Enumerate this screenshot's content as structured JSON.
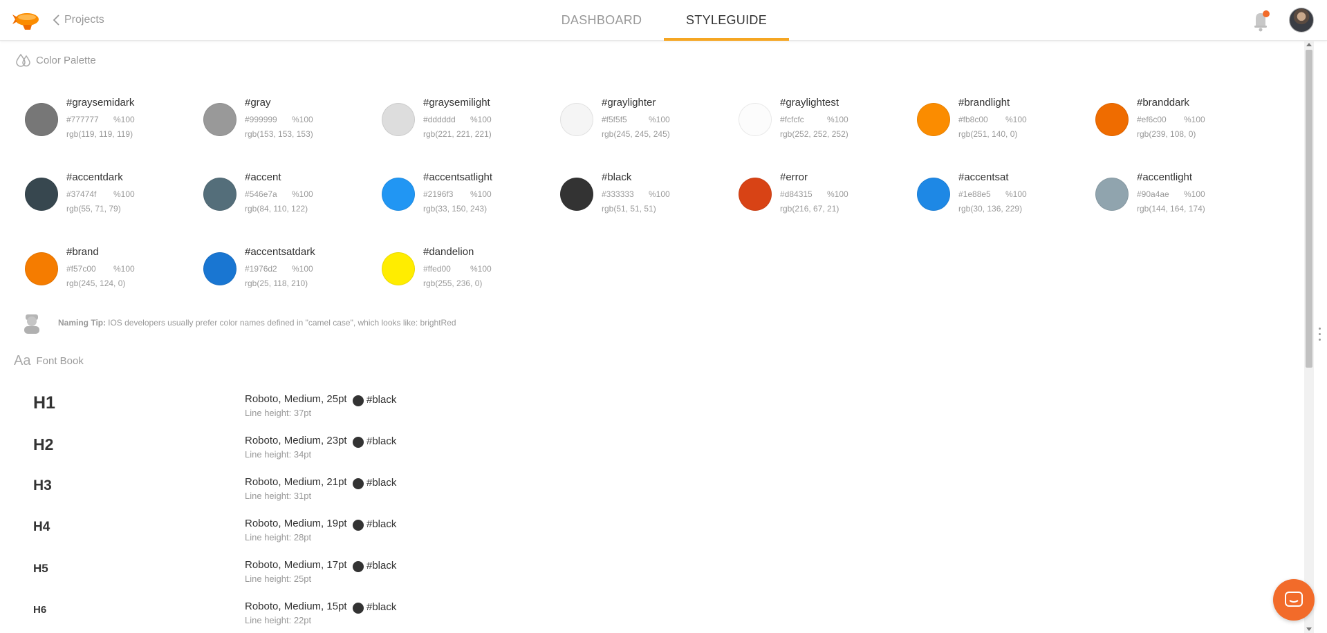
{
  "nav": {
    "back_label": "Projects",
    "tabs": [
      {
        "label": "DASHBOARD",
        "active": false
      },
      {
        "label": "STYLEGUIDE",
        "active": true
      }
    ],
    "accent_color": "#f5a623"
  },
  "color_palette": {
    "title": "Color Palette",
    "swatches": [
      {
        "name": "#graysemidark",
        "hex": "#777777",
        "alpha": "%100",
        "rgb": "rgb(119, 119, 119)"
      },
      {
        "name": "#gray",
        "hex": "#999999",
        "alpha": "%100",
        "rgb": "rgb(153, 153, 153)"
      },
      {
        "name": "#graysemilight",
        "hex": "#dddddd",
        "alpha": "%100",
        "rgb": "rgb(221, 221, 221)"
      },
      {
        "name": "#graylighter",
        "hex": "#f5f5f5",
        "alpha": "%100",
        "rgb": "rgb(245, 245, 245)"
      },
      {
        "name": "#graylightest",
        "hex": "#fcfcfc",
        "alpha": "%100",
        "rgb": "rgb(252, 252, 252)"
      },
      {
        "name": "#brandlight",
        "hex": "#fb8c00",
        "alpha": "%100",
        "rgb": "rgb(251, 140, 0)"
      },
      {
        "name": "#branddark",
        "hex": "#ef6c00",
        "alpha": "%100",
        "rgb": "rgb(239, 108, 0)"
      },
      {
        "name": "#accentdark",
        "hex": "#37474f",
        "alpha": "%100",
        "rgb": "rgb(55, 71, 79)"
      },
      {
        "name": "#accent",
        "hex": "#546e7a",
        "alpha": "%100",
        "rgb": "rgb(84, 110, 122)"
      },
      {
        "name": "#accentsatlight",
        "hex": "#2196f3",
        "alpha": "%100",
        "rgb": "rgb(33, 150, 243)"
      },
      {
        "name": "#black",
        "hex": "#333333",
        "alpha": "%100",
        "rgb": "rgb(51, 51, 51)"
      },
      {
        "name": "#error",
        "hex": "#d84315",
        "alpha": "%100",
        "rgb": "rgb(216, 67, 21)"
      },
      {
        "name": "#accentsat",
        "hex": "#1e88e5",
        "alpha": "%100",
        "rgb": "rgb(30, 136, 229)"
      },
      {
        "name": "#accentlight",
        "hex": "#90a4ae",
        "alpha": "%100",
        "rgb": "rgb(144, 164, 174)"
      },
      {
        "name": "#brand",
        "hex": "#f57c00",
        "alpha": "%100",
        "rgb": "rgb(245, 124, 0)"
      },
      {
        "name": "#accentsatdark",
        "hex": "#1976d2",
        "alpha": "%100",
        "rgb": "rgb(25, 118, 210)"
      },
      {
        "name": "#dandelion",
        "hex": "#ffed00",
        "alpha": "%100",
        "rgb": "rgb(255, 236, 0)"
      }
    ],
    "tip": {
      "label": "Naming Tip:",
      "text": "IOS developers usually prefer color names defined in \"camel case\", which looks like: brightRed"
    }
  },
  "font_book": {
    "icon_text": "Aa",
    "title": "Font Book",
    "styles": [
      {
        "tag": "H1",
        "spec": "Roboto, Medium, 25pt",
        "color_name": "#black",
        "line_height": "Line height: 37pt"
      },
      {
        "tag": "H2",
        "spec": "Roboto, Medium, 23pt",
        "color_name": "#black",
        "line_height": "Line height: 34pt"
      },
      {
        "tag": "H3",
        "spec": "Roboto, Medium, 21pt",
        "color_name": "#black",
        "line_height": "Line height: 31pt"
      },
      {
        "tag": "H4",
        "spec": "Roboto, Medium, 19pt",
        "color_name": "#black",
        "line_height": "Line height: 28pt"
      },
      {
        "tag": "H5",
        "spec": "Roboto, Medium, 17pt",
        "color_name": "#black",
        "line_height": "Line height: 25pt"
      },
      {
        "tag": "H6",
        "spec": "Roboto, Medium, 15pt",
        "color_name": "#black",
        "line_height": "Line height: 22pt"
      }
    ]
  },
  "icons": {
    "logo": "zeppelin-logo-icon",
    "back": "chevron-left-icon",
    "notifications": "bell-icon",
    "palette": "drops-icon",
    "tip": "character-icon",
    "chat": "chat-icon"
  }
}
